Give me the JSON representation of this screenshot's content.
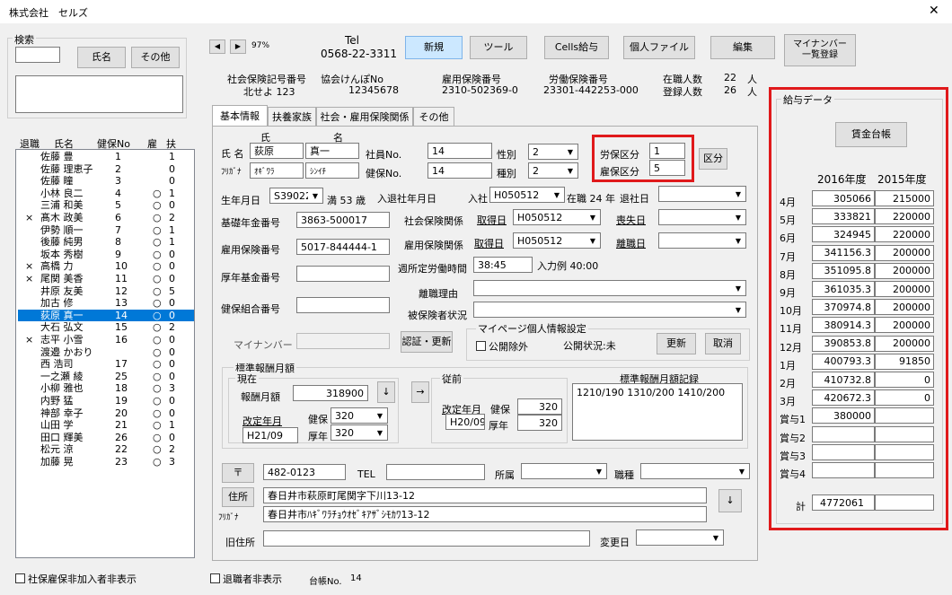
{
  "window": {
    "title": "株式会社　セルズ",
    "close": "✕"
  },
  "search": {
    "group": "検索",
    "name_btn": "氏名",
    "other_btn": "その他"
  },
  "emp_header": {
    "retired": "退職",
    "name": "氏名",
    "kenpo": "健保No",
    "koyo": "雇",
    "fuyo": "扶"
  },
  "employees": [
    {
      "ret": "",
      "name": "佐藤 豊",
      "no": "1",
      "koyo": "",
      "fuyo": "1"
    },
    {
      "ret": "",
      "name": "佐藤 理恵子",
      "no": "2",
      "koyo": "",
      "fuyo": "0"
    },
    {
      "ret": "",
      "name": "佐藤 瞳",
      "no": "3",
      "koyo": "",
      "fuyo": "0"
    },
    {
      "ret": "",
      "name": "小林 良二",
      "no": "4",
      "koyo": "○",
      "fuyo": "1"
    },
    {
      "ret": "",
      "name": "三浦 和美",
      "no": "5",
      "koyo": "○",
      "fuyo": "0"
    },
    {
      "ret": "×",
      "name": "髙木 政美",
      "no": "6",
      "koyo": "○",
      "fuyo": "2"
    },
    {
      "ret": "",
      "name": "伊勢 順一",
      "no": "7",
      "koyo": "○",
      "fuyo": "1"
    },
    {
      "ret": "",
      "name": "後藤 純男",
      "no": "8",
      "koyo": "○",
      "fuyo": "1"
    },
    {
      "ret": "",
      "name": "坂本 秀樹",
      "no": "9",
      "koyo": "○",
      "fuyo": "0"
    },
    {
      "ret": "×",
      "name": "高橋 力",
      "no": "10",
      "koyo": "○",
      "fuyo": "0"
    },
    {
      "ret": "×",
      "name": "尾関 美香",
      "no": "11",
      "koyo": "○",
      "fuyo": "0"
    },
    {
      "ret": "",
      "name": "井原 友美",
      "no": "12",
      "koyo": "○",
      "fuyo": "5"
    },
    {
      "ret": "",
      "name": "加古 修",
      "no": "13",
      "koyo": "○",
      "fuyo": "0"
    },
    {
      "ret": "",
      "name": "荻原 真一",
      "no": "14",
      "koyo": "○",
      "fuyo": "0"
    },
    {
      "ret": "",
      "name": "大石 弘文",
      "no": "15",
      "koyo": "○",
      "fuyo": "2"
    },
    {
      "ret": "×",
      "name": "志平 小雪",
      "no": "16",
      "koyo": "○",
      "fuyo": "0"
    },
    {
      "ret": "",
      "name": "渡邉 かおり",
      "no": "",
      "koyo": "○",
      "fuyo": "0"
    },
    {
      "ret": "",
      "name": "西 浩司",
      "no": "17",
      "koyo": "○",
      "fuyo": "0"
    },
    {
      "ret": "",
      "name": "一之瀬 綾",
      "no": "25",
      "koyo": "○",
      "fuyo": "0"
    },
    {
      "ret": "",
      "name": "小柳 雅也",
      "no": "18",
      "koyo": "○",
      "fuyo": "3"
    },
    {
      "ret": "",
      "name": "内野 猛",
      "no": "19",
      "koyo": "○",
      "fuyo": "0"
    },
    {
      "ret": "",
      "name": "神部 幸子",
      "no": "20",
      "koyo": "○",
      "fuyo": "0"
    },
    {
      "ret": "",
      "name": "山田 学",
      "no": "21",
      "koyo": "○",
      "fuyo": "1"
    },
    {
      "ret": "",
      "name": "田口 輝美",
      "no": "26",
      "koyo": "○",
      "fuyo": "0"
    },
    {
      "ret": "",
      "name": "松元 涼",
      "no": "22",
      "koyo": "○",
      "fuyo": "2"
    },
    {
      "ret": "",
      "name": "加藤 晃",
      "no": "23",
      "koyo": "○",
      "fuyo": "3"
    }
  ],
  "selected_index": 13,
  "bottom": {
    "hide_noninsured": "社保雇保非加入者非表示",
    "hide_retired": "退職者非表示",
    "ledger_label": "台帳No.",
    "ledger_no": "14"
  },
  "toolbar": {
    "zoom": "97%",
    "tel_label": "Tel",
    "tel": "0568-22-3311",
    "new": "新規",
    "tools": "ツール",
    "cells": "Cells給与",
    "personal": "個人ファイル",
    "edit": "編集",
    "mynumber_list": "マイナンバー\n一覧登録"
  },
  "company": {
    "shaho_label": "社会保険記号番号",
    "shaho": "北せよ 123",
    "kyokai_label": "協会けんぽNo",
    "kyokai": "12345678",
    "koyo_label": "雇用保険番号",
    "koyo": "2310-502369-0",
    "rodo_label": "労働保険番号",
    "rodo": "23301-442253-000",
    "zaishoku_label": "在職人数",
    "zaishoku": "22",
    "toroku_label": "登録人数",
    "toroku": "26",
    "nin": "人"
  },
  "tabs": [
    "基本情報",
    "扶養家族",
    "社会・雇用保険関係",
    "その他"
  ],
  "form": {
    "shi": "氏",
    "mei": "名",
    "name_label": "氏 名",
    "sei": "荻原",
    "mei_val": "真一",
    "kana_label": "ﾌﾘｶﾞﾅ",
    "sei_kana": "ｵｷﾞﾜﾗ",
    "mei_kana": "ｼﾝｲﾁ",
    "shain_label": "社員No.",
    "shain_no": "14",
    "kenpo_label": "健保No.",
    "kenpo_no": "14",
    "seibetsu_label": "性別",
    "seibetsu": "2",
    "shubetsu_label": "種別",
    "shubetsu": "2",
    "rouho_label": "労保区分",
    "rouho": "1",
    "koho_label": "雇保区分",
    "koho": "5",
    "kubun_btn": "区分",
    "birth_label": "生年月日",
    "birth": "S390224",
    "age": "満 53 歳",
    "nyutai_label": "入退社年月日",
    "nyusha": "入社",
    "nyusha_date": "H050512",
    "zaishoku": "在職 24 年",
    "taisha_label": "退社日",
    "kiso_label": "基礎年金番号",
    "kiso": "3863-500017",
    "shaho_rel": "社会保険関係",
    "shutoku": "取得日",
    "shaho_shutoku": "H050512",
    "soshitsu": "喪失日",
    "koyo_label": "雇用保険番号",
    "koyo": "5017-844444-1",
    "koyo_rel": "雇用保険関係",
    "koyo_shutoku": "H050512",
    "rishoku": "離職日",
    "shotei_label": "週所定労働時間",
    "shotei": "38:45",
    "example": "入力例 40:00",
    "kosei_label": "厚年基金番号",
    "rishoku_riyu": "離職理由",
    "kenpo_kumiai": "健保組合番号",
    "hihoken": "被保険者状況",
    "mynumber": "マイナンバー",
    "auth_btn": "認証・更新",
    "mypage_group": "マイページ個人情報設定",
    "public_excl": "公開除外",
    "public_status": "公開状況:未",
    "update_btn": "更新",
    "cancel_btn": "取消",
    "hyojun_group": "標準報酬月額",
    "genzai": "現在",
    "hoshu_label": "報酬月額",
    "hoshu": "318900",
    "kaitei_label": "改定年月",
    "kaitei": "H21/09",
    "kenpo_s": "健保",
    "kenpo_val": "320",
    "kosei_s": "厚年",
    "kosei_val": "320",
    "jyuzen": "従前",
    "prev_kaitei_label": "改定年月",
    "prev_kaitei": "H20/09",
    "prev_kenpo": "320",
    "prev_kosei": "320",
    "kiroku_label": "標準報酬月額記録",
    "kiroku": "1210/190 1310/200 1410/200",
    "zip_btn": "〒",
    "zip": "482-0123",
    "tel_label": "TEL",
    "shozoku": "所属",
    "shokushu": "職種",
    "address_btn": "住所",
    "address": "春日井市萩原町尾関字下川13-12",
    "addr_kana_label": "ﾌﾘｶﾞﾅ",
    "address_kana": "春日井市ﾊｷﾞﾜﾗﾁｮｳｵｾﾞｷｱｻﾞｼﾓｶﾜ13-12",
    "old_address": "旧住所",
    "change_date": "変更日",
    "down_arrow": "↓",
    "right_arrow": "→"
  },
  "pay": {
    "group": "給与データ",
    "ledger_btn": "賃金台帳",
    "y1": "2016年度",
    "y2": "2015年度",
    "total_label": "計",
    "total": "4772061",
    "rows": [
      {
        "m": "4月",
        "a": "305066",
        "b": "215000"
      },
      {
        "m": "5月",
        "a": "333821",
        "b": "220000"
      },
      {
        "m": "6月",
        "a": "324945",
        "b": "220000"
      },
      {
        "m": "7月",
        "a": "341156.3",
        "b": "200000"
      },
      {
        "m": "8月",
        "a": "351095.8",
        "b": "200000"
      },
      {
        "m": "9月",
        "a": "361035.3",
        "b": "200000"
      },
      {
        "m": "10月",
        "a": "370974.8",
        "b": "200000"
      },
      {
        "m": "11月",
        "a": "380914.3",
        "b": "200000"
      },
      {
        "m": "12月",
        "a": "390853.8",
        "b": "200000"
      },
      {
        "m": "1月",
        "a": "400793.3",
        "b": "91850"
      },
      {
        "m": "2月",
        "a": "410732.8",
        "b": "0"
      },
      {
        "m": "3月",
        "a": "420672.3",
        "b": "0"
      },
      {
        "m": "賞与1",
        "a": "380000",
        "b": ""
      },
      {
        "m": "賞与2",
        "a": "",
        "b": ""
      },
      {
        "m": "賞与3",
        "a": "",
        "b": ""
      },
      {
        "m": "賞与4",
        "a": "",
        "b": ""
      }
    ]
  },
  "highlight_color": "#e0191b"
}
